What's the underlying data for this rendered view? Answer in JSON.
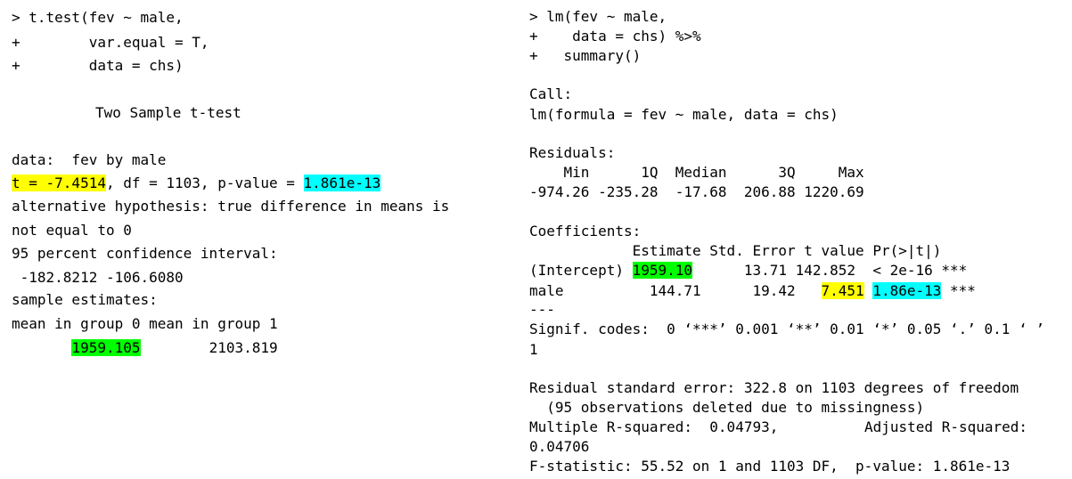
{
  "left": {
    "cmd1": "> t.test(fev ~ male,",
    "cmd2": "+        var.equal = T,",
    "cmd3": "+        data = chs)",
    "title": "Two Sample t-test",
    "data_line": "data:  fev by male",
    "tval": "t = -7.4514",
    "df_part": ", df = 1103, p-value = ",
    "pval": "1.861e-13",
    "alt1": "alternative hypothesis: true difference in means is",
    "alt2": "not equal to 0",
    "ci_label": "95 percent confidence interval:",
    "ci_vals": " -182.8212 -106.6080",
    "est_label": "sample estimates:",
    "est_head": "mean in group 0 mean in group 1",
    "est_pad": "       ",
    "est_g0": "1959.105",
    "est_mid": "        ",
    "est_g1": "2103.819"
  },
  "right": {
    "cmd1": "> lm(fev ~ male,",
    "cmd2": "+    data = chs) %>%",
    "cmd3": "+   summary()",
    "call_label": "Call:",
    "call": "lm(formula = fev ~ male, data = chs)",
    "resid_label": "Residuals:",
    "resid_head": "    Min      1Q  Median      3Q     Max",
    "resid_vals": "-974.26 -235.28  -17.68  206.88 1220.69",
    "coef_label": "Coefficients:",
    "coef_head": "            Estimate Std. Error t value Pr(>|t|)",
    "int_name": "(Intercept) ",
    "int_est": "1959.10",
    "int_rest": "      13.71 142.852  < 2e-16 ***",
    "male_name": "male          144.71      19.42   ",
    "male_t": "7.451",
    "male_sp": " ",
    "male_p": "1.86e-13",
    "male_stars": " ***",
    "sep": "---",
    "signif": "Signif. codes:  0 ‘***’ 0.001 ‘**’ 0.01 ‘*’ 0.05 ‘.’ 0.1 ‘ ’",
    "signif2": "1",
    "rse": "Residual standard error: 322.8 on 1103 degrees of freedom",
    "missing": "  (95 observations deleted due to missingness)",
    "r2": "Multiple R-squared:  0.04793,\tAdjusted R-squared:",
    "r2b": "0.04706",
    "fstat": "F-statistic: 55.52 on 1 and 1103 DF,  p-value: 1.861e-13"
  },
  "colors": {
    "yellow": "#ffff00",
    "cyan": "#00ffff",
    "green": "#00ff00"
  }
}
